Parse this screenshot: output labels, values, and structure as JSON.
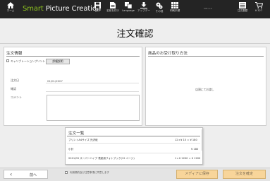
{
  "app": {
    "title_accent": "Smart",
    "title_rest": " Picture Creation",
    "version": "ver.x.x"
  },
  "toolbar": {
    "home": "ホーム",
    "save": "保存",
    "save_as": "名前を付け",
    "language": "Language",
    "update": "アップデー",
    "other": "その他",
    "print_help": "印刷手順",
    "order_history": "注文履歴",
    "order_badge": "0",
    "cart": "¥ 327"
  },
  "page_title": "注文確認",
  "order_info": {
    "title": "注文情報",
    "registration_label": "キャリブレーションプリント",
    "detail_button": "詳細説明",
    "order_date_label": "注文日",
    "order_date_value": "01/01/2007",
    "phone_label": "確認",
    "comment_label": "コメント"
  },
  "pickup": {
    "title": "商品のお受け取り方法",
    "placeholder": "店頭にてお渡し"
  },
  "order_list": {
    "title": "注文一覧",
    "items": [
      {
        "name": "プリントA4サイズ 光沢紙",
        "detail": "12ｘ¥ 15 = ¥ 180"
      },
      {
        "name": "小計",
        "detail": "¥ 180"
      },
      {
        "name": "2011/03 スーパーハイブ 表紙用フォトブック(12 ページ)",
        "detail": "1ｘ¥ 1200 = ¥ 1200"
      }
    ]
  },
  "footer": {
    "back": "前へ",
    "agree": "利用規約及び注意事項に同意します",
    "save_media": "メディアに保存",
    "confirm": "注文を確定"
  },
  "colors": {
    "header_bg": "#242424",
    "accent": "#8dc21f",
    "action_button": "#f8d59a"
  }
}
